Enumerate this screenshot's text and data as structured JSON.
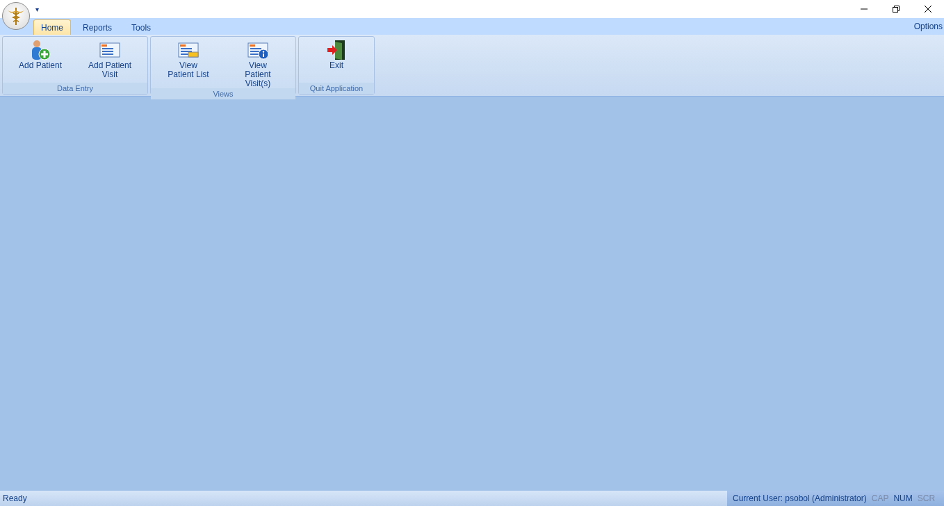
{
  "quick_access": {
    "menu": "▾"
  },
  "tabs": [
    {
      "label": "Home",
      "selected": true
    },
    {
      "label": "Reports",
      "selected": false
    },
    {
      "label": "Tools",
      "selected": false
    }
  ],
  "options": "Options",
  "groups": [
    {
      "label": "Data Entry",
      "buttons": [
        {
          "kind": "add-person",
          "label": "Add Patient"
        },
        {
          "kind": "form",
          "label": "Add Patient Visit"
        }
      ]
    },
    {
      "label": "Views",
      "buttons": [
        {
          "kind": "list",
          "label": "View Patient List"
        },
        {
          "kind": "info",
          "label": "View Patient Visit(s)"
        }
      ]
    },
    {
      "label": "Quit Application",
      "buttons": [
        {
          "kind": "exit",
          "label": "Exit"
        }
      ]
    }
  ],
  "status_bar": {
    "message": "Ready",
    "user": "Current User: psobol (Administrator)",
    "indicators": [
      {
        "label": "CAP",
        "on": false
      },
      {
        "label": "NUM",
        "on": true
      },
      {
        "label": "SCR",
        "on": false
      }
    ]
  }
}
